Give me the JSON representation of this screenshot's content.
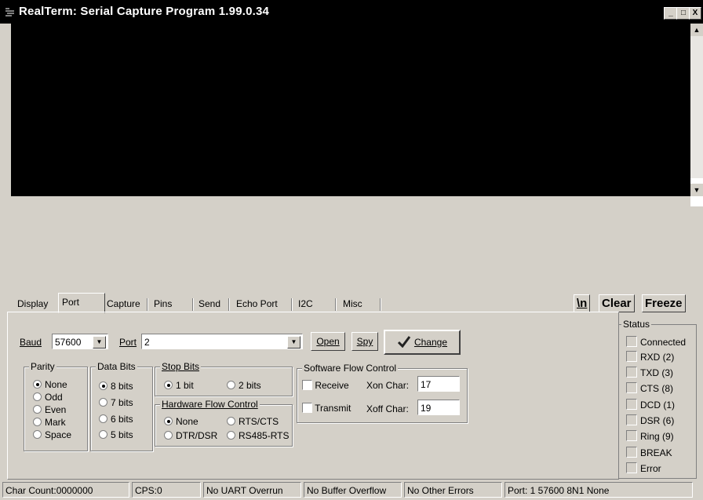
{
  "window": {
    "title": "RealTerm: Serial Capture Program 1.99.0.34",
    "min": "_",
    "max": "□",
    "close": "X"
  },
  "tabs": [
    "Display",
    "Port",
    "Capture",
    "Pins",
    "Send",
    "Echo Port",
    "I2C",
    "Misc"
  ],
  "toolbar": {
    "newline": "\\n",
    "clear": "Clear",
    "freeze": "Freeze"
  },
  "port": {
    "baud_label": "Baud",
    "baud_value": "57600",
    "port_label": "Port",
    "port_value": "2",
    "open_label": "Open",
    "spy_label": "Spy",
    "change_label": "Change"
  },
  "parity": {
    "title": "Parity",
    "options": [
      "None",
      "Odd",
      "Even",
      "Mark",
      "Space"
    ],
    "selected": "None"
  },
  "data_bits": {
    "title": "Data Bits",
    "options": [
      "8 bits",
      "7 bits",
      "6 bits",
      "5 bits"
    ],
    "selected": "8 bits"
  },
  "stop_bits": {
    "title": "Stop Bits",
    "options": [
      "1 bit",
      "2 bits"
    ],
    "selected": "1 bit"
  },
  "hw_flow": {
    "title": "Hardware Flow Control",
    "options": [
      "None",
      "RTS/CTS",
      "DTR/DSR",
      "RS485-RTS"
    ],
    "selected": "None"
  },
  "sw_flow": {
    "title": "Software Flow Control",
    "receive_label": "Receive",
    "transmit_label": "Transmit",
    "xon_label": "Xon Char:",
    "xon_value": "17",
    "xoff_label": "Xoff Char:",
    "xoff_value": "19"
  },
  "status": {
    "title": "Status",
    "items": [
      "Connected",
      "RXD (2)",
      "TXD (3)",
      "CTS (8)",
      "DCD (1)",
      "DSR (6)",
      "Ring (9)",
      "BREAK",
      "Error"
    ]
  },
  "statusbar": {
    "char_count": "Char Count:0000000",
    "cps": "CPS:0",
    "uart": "No UART Overrun",
    "buffer": "No Buffer Overflow",
    "other": "No Other Errors",
    "port_info": "Port: 1 57600 8N1 None"
  }
}
